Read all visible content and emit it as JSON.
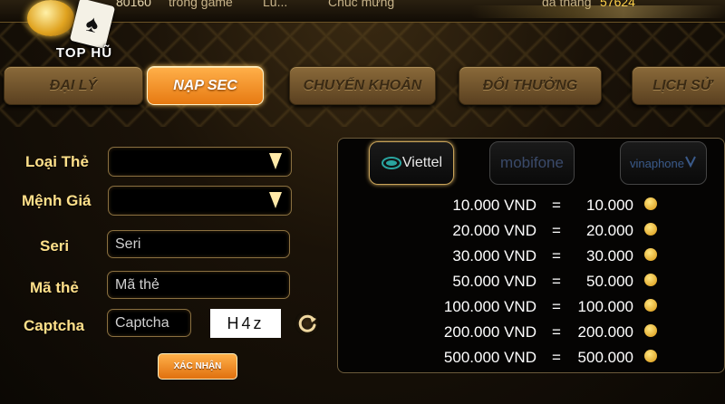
{
  "ticker": {
    "t1": "80160",
    "t2": "trong game",
    "t3": "Lu...",
    "t4": "Chúc mừng",
    "t5": "đã thắng",
    "t6": "57624"
  },
  "logo": {
    "title": "TOP HŨ"
  },
  "tabs": [
    {
      "label": "ĐẠI LÝ"
    },
    {
      "label": "NẠP SEC"
    },
    {
      "label": "CHUYỂN KHOẢN"
    },
    {
      "label": "ĐỔI THƯỞNG"
    },
    {
      "label": "LỊCH SỬ"
    }
  ],
  "form": {
    "card_type_label": "Loại Thẻ",
    "denomination_label": "Mệnh Giá",
    "serial_label": "Seri",
    "serial_placeholder": "Seri",
    "card_code_label": "Mã thẻ",
    "card_code_placeholder": "Mã thẻ",
    "captcha_label": "Captcha",
    "captcha_placeholder": "Captcha",
    "captcha_code": "H4z",
    "confirm_label": "XÁC NHẬN"
  },
  "providers": {
    "viettel": "Viettel",
    "mobifone": "mobifone",
    "vinaphone": "vinaphone"
  },
  "rates": [
    {
      "vnd": "10.000 VND",
      "eq": "=",
      "value": "10.000"
    },
    {
      "vnd": "20.000 VND",
      "eq": "=",
      "value": "20.000"
    },
    {
      "vnd": "30.000 VND",
      "eq": "=",
      "value": "30.000"
    },
    {
      "vnd": "50.000 VND",
      "eq": "=",
      "value": "50.000"
    },
    {
      "vnd": "100.000 VND",
      "eq": "=",
      "value": "100.000"
    },
    {
      "vnd": "200.000 VND",
      "eq": "=",
      "value": "200.000"
    },
    {
      "vnd": "500.000 VND",
      "eq": "=",
      "value": "500.000"
    }
  ],
  "colors": {
    "accent_orange": "#e77a12",
    "label_gold": "#ffe08a",
    "background": "#0d0904"
  },
  "icons": {
    "dropdown": "chevron-down-icon",
    "refresh": "refresh-icon",
    "coin": "coin-icon"
  }
}
